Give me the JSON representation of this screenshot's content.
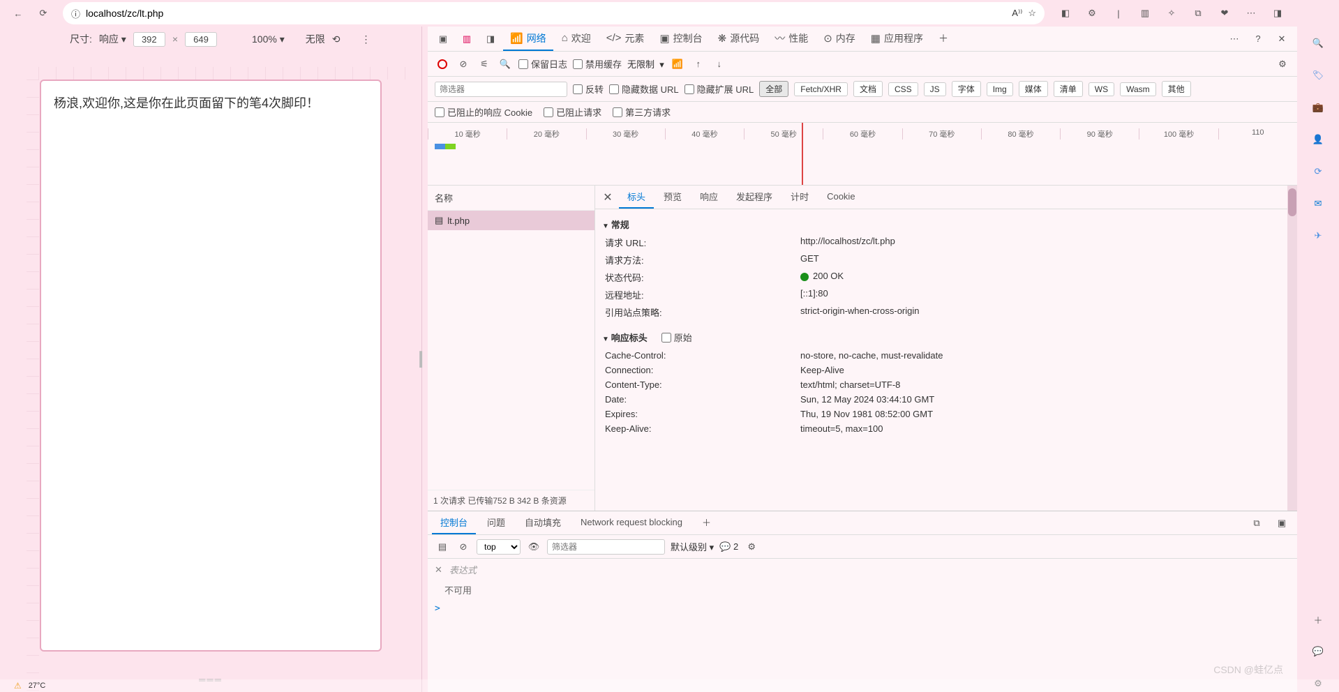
{
  "address_bar": {
    "url": "localhost/zc/lt.php",
    "info_icon": "ⓘ",
    "back": "←",
    "reload": "⟳",
    "read_aloud": "A⁾⁾",
    "star": "☆"
  },
  "right_icons": [
    "◧",
    "⚙",
    "|",
    "▥",
    "✧",
    "⧉",
    "❤",
    "⋯",
    "◨"
  ],
  "sidebar": {
    "items": [
      "🔍",
      "🏷",
      "💼",
      "👤",
      "⟳",
      "✉",
      "✈",
      "＋",
      "💬",
      "⚙"
    ]
  },
  "device_toolbar": {
    "label_size": "尺寸:",
    "mode": "响应",
    "w": "392",
    "h": "649",
    "x": "×",
    "zoom": "100%",
    "throttle": "无限",
    "more": "⋮"
  },
  "page_content": {
    "text": "杨浪,欢迎你,这是你在此页面留下的笔4次脚印！"
  },
  "devtools_tabs": {
    "items": [
      "欢迎",
      "元素",
      "控制台",
      "源代码",
      "性能",
      "内存",
      "应用程序"
    ],
    "network": "网络",
    "plus": "＋",
    "more": "⋯",
    "help": "?",
    "close": "✕"
  },
  "net_toolbar": {
    "preserve": "保留日志",
    "disable_cache": "禁用缓存",
    "throttle": "无限制"
  },
  "filters": {
    "placeholder": "筛选器",
    "invert": "反转",
    "hide_data": "隐藏数据 URL",
    "hide_ext": "隐藏扩展 URL",
    "pills": [
      "全部",
      "Fetch/XHR",
      "文档",
      "CSS",
      "JS",
      "字体",
      "Img",
      "媒体",
      "清单",
      "WS",
      "Wasm",
      "其他"
    ]
  },
  "blocked_row": {
    "cookie": "已阻止的响应 Cookie",
    "req": "已阻止请求",
    "third": "第三方请求"
  },
  "timeline": {
    "ticks": [
      "10 毫秒",
      "20 毫秒",
      "30 毫秒",
      "40 毫秒",
      "50 毫秒",
      "60 毫秒",
      "70 毫秒",
      "80 毫秒",
      "90 毫秒",
      "100 毫秒",
      "110"
    ]
  },
  "request_list": {
    "header": "名称",
    "items": [
      "lt.php"
    ],
    "footer": "1 次请求  已传输752 B  342 B 条资源"
  },
  "detail_tabs": {
    "items": [
      "标头",
      "预览",
      "响应",
      "发起程序",
      "计时",
      "Cookie"
    ],
    "active": 0
  },
  "general": {
    "title": "常规",
    "rows": [
      {
        "k": "请求 URL:",
        "v": "http://localhost/zc/lt.php"
      },
      {
        "k": "请求方法:",
        "v": "GET"
      },
      {
        "k": "状态代码:",
        "v": "200 OK",
        "status": true
      },
      {
        "k": "远程地址:",
        "v": "[::1]:80"
      },
      {
        "k": "引用站点策略:",
        "v": "strict-origin-when-cross-origin"
      }
    ]
  },
  "resp_headers": {
    "title": "响应标头",
    "raw": "原始",
    "rows": [
      {
        "k": "Cache-Control:",
        "v": "no-store, no-cache, must-revalidate"
      },
      {
        "k": "Connection:",
        "v": "Keep-Alive"
      },
      {
        "k": "Content-Type:",
        "v": "text/html; charset=UTF-8"
      },
      {
        "k": "Date:",
        "v": "Sun, 12 May 2024 03:44:10 GMT"
      },
      {
        "k": "Expires:",
        "v": "Thu, 19 Nov 1981 08:52:00 GMT"
      },
      {
        "k": "Keep-Alive:",
        "v": "timeout=5, max=100"
      }
    ]
  },
  "drawer": {
    "tabs": [
      "控制台",
      "问题",
      "自动填充",
      "Network request blocking"
    ],
    "active": 0,
    "top": "top",
    "level": "默认级别",
    "count": "2",
    "filter": "筛选器",
    "expr": "表达式",
    "nouse": "不可用",
    "prompt": ">"
  },
  "taskbar": {
    "temp": "27°C"
  },
  "watermark": "CSDN @蛙亿点"
}
